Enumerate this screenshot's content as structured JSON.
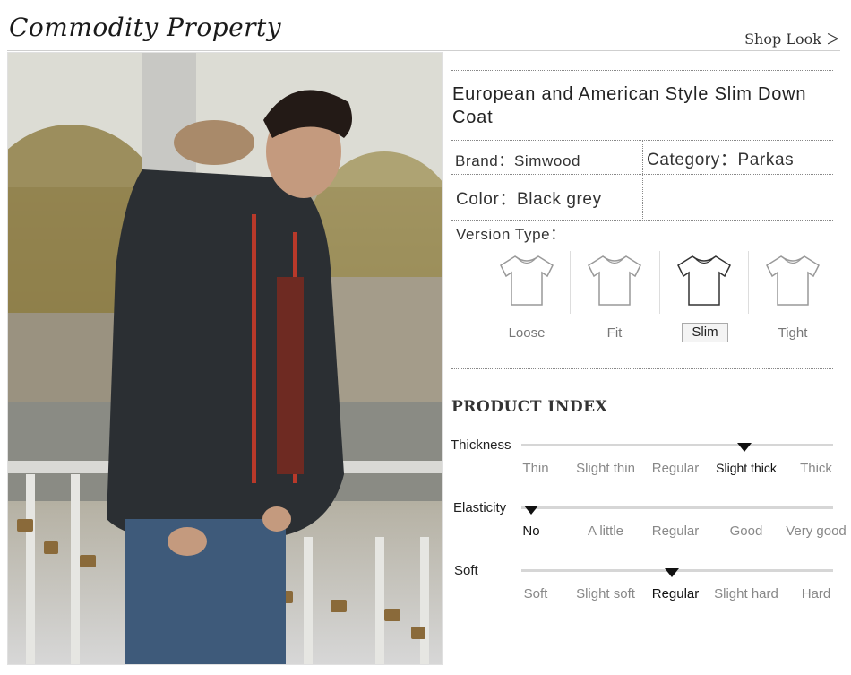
{
  "header": {
    "title": "Commodity Property",
    "shop_link": "Shop Look ＞"
  },
  "product": {
    "name": "European and American Style Slim Down Coat",
    "brand_label": "Brand：Simwood",
    "category_label": "Category：Parkas",
    "color_label": "Color：Black grey",
    "version_label": "Version Type："
  },
  "version_types": [
    {
      "label": "Loose",
      "selected": false
    },
    {
      "label": "Fit",
      "selected": false
    },
    {
      "label": "Slim",
      "selected": true
    },
    {
      "label": "Tight",
      "selected": false
    }
  ],
  "product_index": {
    "title": "PRODUCT INDEX",
    "rows": [
      {
        "name": "Thickness",
        "options": [
          "Thin",
          "Slight thin",
          "Regular",
          "Slight thick",
          "Thick"
        ],
        "selected": 3
      },
      {
        "name": "Elasticity",
        "options": [
          "No",
          "A little",
          "Regular",
          "Good",
          "Very good"
        ],
        "selected": 0
      },
      {
        "name": "Soft",
        "options": [
          "Soft",
          "Slight soft",
          "Regular",
          "Slight hard",
          "Hard"
        ],
        "selected": 2
      }
    ]
  },
  "colors": {
    "line": "#d6d6d6",
    "marker": "#111111",
    "coat": "#2b2f33",
    "zipper": "#b8392a"
  }
}
